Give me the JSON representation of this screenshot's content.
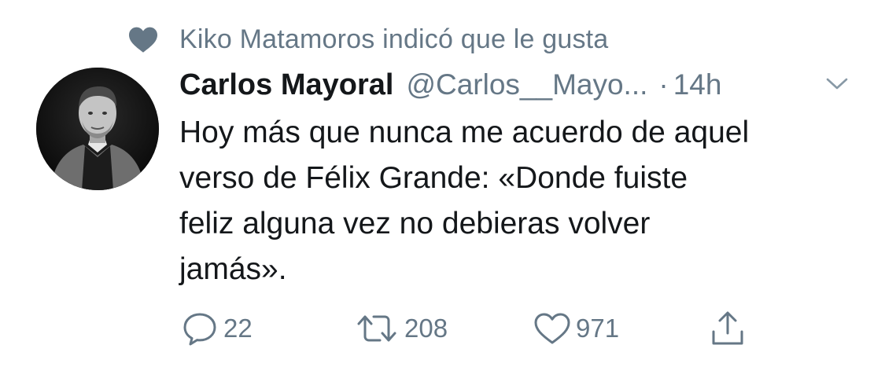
{
  "social_context": {
    "icon": "heart-icon",
    "text": "Kiko Matamoros indicó que le gusta"
  },
  "tweet": {
    "avatar": "avatar-photo",
    "display_name": "Carlos Mayoral",
    "handle": "@Carlos__Mayo...",
    "separator": "·",
    "time": "14h",
    "menu_icon": "chevron-down-icon",
    "text": "Hoy más que nunca me acuerdo de aquel\nverso de Félix Grande: «Donde fuiste\nfeliz alguna vez no debieras volver\njamás»."
  },
  "actions": {
    "reply_count": "22",
    "retweet_count": "208",
    "like_count": "971"
  },
  "colors": {
    "primary_text": "#14171a",
    "secondary_text": "#657786"
  }
}
